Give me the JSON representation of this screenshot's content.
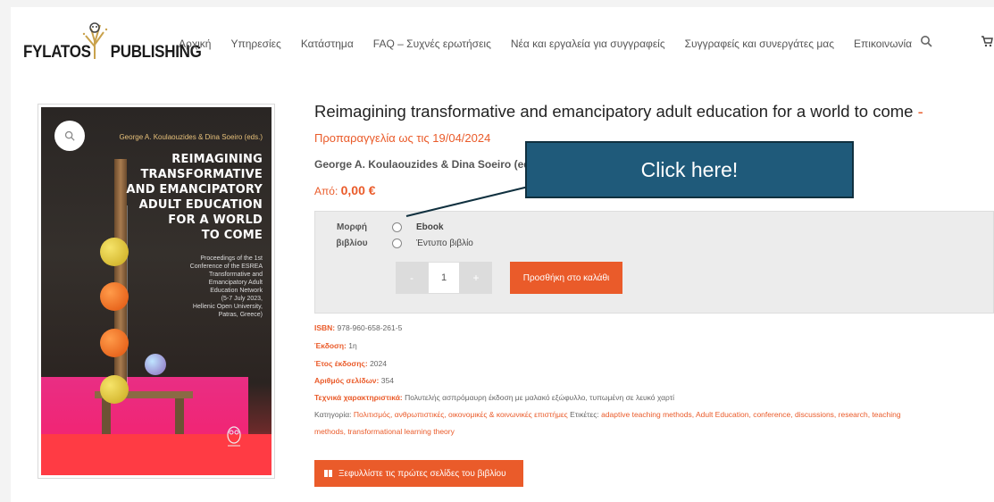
{
  "brand": {
    "left": "FYLATOS",
    "right": "PUBLISHING"
  },
  "nav": [
    "Αρχική",
    "Υπηρεσίες",
    "Κατάστημα",
    "FAQ – Συχνές ερωτήσεις",
    "Νέα και εργαλεία για συγγραφείς",
    "Συγγραφείς και συνεργάτες μας",
    "Επικοινωνία"
  ],
  "cover": {
    "authors": "George A. Koulaouzides & Dina Soeiro (eds.)",
    "title": "REIMAGINING\nTRANSFORMATIVE\nAND EMANCIPATORY\nADULT EDUCATION\nFOR A WORLD\nTO COME",
    "subtitle": "Proceedings of the 1st\nConference of the ESREA\nTransformative and\nEmancipatory Adult\nEducation Network\n(5-7 July 2023,\nHellenic Open University,\nPatras, Greece)"
  },
  "product": {
    "title": "Reimagining transformative and emancipatory adult education for a world to come",
    "title_dash": " -",
    "preorder": "Προπαραγγελία ως τις 19/04/2024",
    "authors": "George A. Koulaouzides & Dina Soeiro (eds.)",
    "price_prefix": "Από: ",
    "price": "0,00 €"
  },
  "tooltip": "Click here!",
  "variation": {
    "label": "Μορφή\nβιβλίου",
    "options": [
      "Ebook",
      "Έντυπο βιβλίο"
    ],
    "qty_minus": "-",
    "qty_value": "1",
    "qty_plus": "+",
    "add_to_cart": "Προσθήκη στο καλάθι"
  },
  "meta": {
    "isbn_k": "ISBN:",
    "isbn_v": "978-960-658-261-5",
    "edition_k": "Έκδοση:",
    "edition_v": "1η",
    "year_k": "Έτος έκδοσης:",
    "year_v": "2024",
    "pages_k": "Αριθμός σελίδων:",
    "pages_v": "354",
    "tech_k": "Τεχνικά χαρακτηριστικά:",
    "tech_v": "Πολυτελής ασπρόμαυρη έκδοση με μαλακό εξώφυλλο, τυπωμένη σε λευκό χαρτί",
    "cat_k": "Κατηγορία:",
    "cat_v": "Πολιτισμός, ανθρωπιστικές, οικονομικές & κοινωνικές επιστήμες",
    "tags_k": "Ετικέτες:",
    "tags_v1": "adaptive teaching methods, Adult Education, conference, discussions, research, teaching",
    "tags_v2": "methods, transformational learning theory"
  },
  "preview_button": "Ξεφυλλίστε τις πρώτες σελίδες του βιβλίου",
  "colors": {
    "accent": "#ea5b2a",
    "tooltip": "#1f5a7a"
  }
}
